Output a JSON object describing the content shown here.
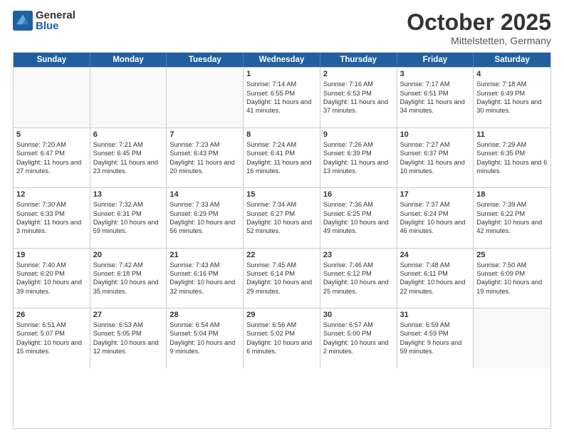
{
  "logo": {
    "general": "General",
    "blue": "Blue"
  },
  "title": "October 2025",
  "subtitle": "Mittelstetten, Germany",
  "header": {
    "days": [
      "Sunday",
      "Monday",
      "Tuesday",
      "Wednesday",
      "Thursday",
      "Friday",
      "Saturday"
    ]
  },
  "weeks": [
    [
      {
        "day": "",
        "info": ""
      },
      {
        "day": "",
        "info": ""
      },
      {
        "day": "",
        "info": ""
      },
      {
        "day": "1",
        "sunrise": "Sunrise: 7:14 AM",
        "sunset": "Sunset: 6:55 PM",
        "daylight": "Daylight: 11 hours and 41 minutes."
      },
      {
        "day": "2",
        "sunrise": "Sunrise: 7:16 AM",
        "sunset": "Sunset: 6:53 PM",
        "daylight": "Daylight: 11 hours and 37 minutes."
      },
      {
        "day": "3",
        "sunrise": "Sunrise: 7:17 AM",
        "sunset": "Sunset: 6:51 PM",
        "daylight": "Daylight: 11 hours and 34 minutes."
      },
      {
        "day": "4",
        "sunrise": "Sunrise: 7:18 AM",
        "sunset": "Sunset: 6:49 PM",
        "daylight": "Daylight: 11 hours and 30 minutes."
      }
    ],
    [
      {
        "day": "5",
        "sunrise": "Sunrise: 7:20 AM",
        "sunset": "Sunset: 6:47 PM",
        "daylight": "Daylight: 11 hours and 27 minutes."
      },
      {
        "day": "6",
        "sunrise": "Sunrise: 7:21 AM",
        "sunset": "Sunset: 6:45 PM",
        "daylight": "Daylight: 11 hours and 23 minutes."
      },
      {
        "day": "7",
        "sunrise": "Sunrise: 7:23 AM",
        "sunset": "Sunset: 6:43 PM",
        "daylight": "Daylight: 11 hours and 20 minutes."
      },
      {
        "day": "8",
        "sunrise": "Sunrise: 7:24 AM",
        "sunset": "Sunset: 6:41 PM",
        "daylight": "Daylight: 11 hours and 16 minutes."
      },
      {
        "day": "9",
        "sunrise": "Sunrise: 7:26 AM",
        "sunset": "Sunset: 6:39 PM",
        "daylight": "Daylight: 11 hours and 13 minutes."
      },
      {
        "day": "10",
        "sunrise": "Sunrise: 7:27 AM",
        "sunset": "Sunset: 6:37 PM",
        "daylight": "Daylight: 11 hours and 10 minutes."
      },
      {
        "day": "11",
        "sunrise": "Sunrise: 7:29 AM",
        "sunset": "Sunset: 6:35 PM",
        "daylight": "Daylight: 11 hours and 6 minutes."
      }
    ],
    [
      {
        "day": "12",
        "sunrise": "Sunrise: 7:30 AM",
        "sunset": "Sunset: 6:33 PM",
        "daylight": "Daylight: 11 hours and 3 minutes."
      },
      {
        "day": "13",
        "sunrise": "Sunrise: 7:32 AM",
        "sunset": "Sunset: 6:31 PM",
        "daylight": "Daylight: 10 hours and 59 minutes."
      },
      {
        "day": "14",
        "sunrise": "Sunrise: 7:33 AM",
        "sunset": "Sunset: 6:29 PM",
        "daylight": "Daylight: 10 hours and 56 minutes."
      },
      {
        "day": "15",
        "sunrise": "Sunrise: 7:34 AM",
        "sunset": "Sunset: 6:27 PM",
        "daylight": "Daylight: 10 hours and 52 minutes."
      },
      {
        "day": "16",
        "sunrise": "Sunrise: 7:36 AM",
        "sunset": "Sunset: 6:25 PM",
        "daylight": "Daylight: 10 hours and 49 minutes."
      },
      {
        "day": "17",
        "sunrise": "Sunrise: 7:37 AM",
        "sunset": "Sunset: 6:24 PM",
        "daylight": "Daylight: 10 hours and 46 minutes."
      },
      {
        "day": "18",
        "sunrise": "Sunrise: 7:39 AM",
        "sunset": "Sunset: 6:22 PM",
        "daylight": "Daylight: 10 hours and 42 minutes."
      }
    ],
    [
      {
        "day": "19",
        "sunrise": "Sunrise: 7:40 AM",
        "sunset": "Sunset: 6:20 PM",
        "daylight": "Daylight: 10 hours and 39 minutes."
      },
      {
        "day": "20",
        "sunrise": "Sunrise: 7:42 AM",
        "sunset": "Sunset: 6:18 PM",
        "daylight": "Daylight: 10 hours and 35 minutes."
      },
      {
        "day": "21",
        "sunrise": "Sunrise: 7:43 AM",
        "sunset": "Sunset: 6:16 PM",
        "daylight": "Daylight: 10 hours and 32 minutes."
      },
      {
        "day": "22",
        "sunrise": "Sunrise: 7:45 AM",
        "sunset": "Sunset: 6:14 PM",
        "daylight": "Daylight: 10 hours and 29 minutes."
      },
      {
        "day": "23",
        "sunrise": "Sunrise: 7:46 AM",
        "sunset": "Sunset: 6:12 PM",
        "daylight": "Daylight: 10 hours and 25 minutes."
      },
      {
        "day": "24",
        "sunrise": "Sunrise: 7:48 AM",
        "sunset": "Sunset: 6:11 PM",
        "daylight": "Daylight: 10 hours and 22 minutes."
      },
      {
        "day": "25",
        "sunrise": "Sunrise: 7:50 AM",
        "sunset": "Sunset: 6:09 PM",
        "daylight": "Daylight: 10 hours and 19 minutes."
      }
    ],
    [
      {
        "day": "26",
        "sunrise": "Sunrise: 6:51 AM",
        "sunset": "Sunset: 5:07 PM",
        "daylight": "Daylight: 10 hours and 15 minutes."
      },
      {
        "day": "27",
        "sunrise": "Sunrise: 6:53 AM",
        "sunset": "Sunset: 5:05 PM",
        "daylight": "Daylight: 10 hours and 12 minutes."
      },
      {
        "day": "28",
        "sunrise": "Sunrise: 6:54 AM",
        "sunset": "Sunset: 5:04 PM",
        "daylight": "Daylight: 10 hours and 9 minutes."
      },
      {
        "day": "29",
        "sunrise": "Sunrise: 6:56 AM",
        "sunset": "Sunset: 5:02 PM",
        "daylight": "Daylight: 10 hours and 6 minutes."
      },
      {
        "day": "30",
        "sunrise": "Sunrise: 6:57 AM",
        "sunset": "Sunset: 5:00 PM",
        "daylight": "Daylight: 10 hours and 2 minutes."
      },
      {
        "day": "31",
        "sunrise": "Sunrise: 6:59 AM",
        "sunset": "Sunset: 4:59 PM",
        "daylight": "Daylight: 9 hours and 59 minutes."
      },
      {
        "day": "",
        "info": ""
      }
    ]
  ]
}
